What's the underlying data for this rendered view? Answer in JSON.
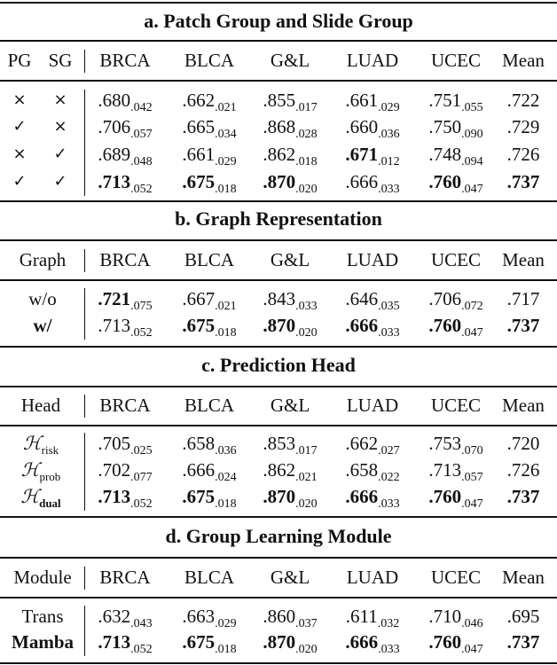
{
  "columns": [
    "BRCA",
    "BLCA",
    "G&L",
    "LUAD",
    "UCEC",
    "Mean"
  ],
  "sections": [
    {
      "title": "a. Patch Group and Slide Group",
      "row_headers": [
        "PG",
        "SG"
      ],
      "rows": [
        {
          "labels": [
            "cross",
            "cross"
          ],
          "values": [
            {
              "v": ".680",
              "s": ".042",
              "b": false
            },
            {
              "v": ".662",
              "s": ".021",
              "b": false
            },
            {
              "v": ".855",
              "s": ".017",
              "b": false
            },
            {
              "v": ".661",
              "s": ".029",
              "b": false
            },
            {
              "v": ".751",
              "s": ".055",
              "b": false
            },
            {
              "v": ".722",
              "s": "",
              "b": false
            }
          ]
        },
        {
          "labels": [
            "check",
            "cross"
          ],
          "values": [
            {
              "v": ".706",
              "s": ".057",
              "b": false
            },
            {
              "v": ".665",
              "s": ".034",
              "b": false
            },
            {
              "v": ".868",
              "s": ".028",
              "b": false
            },
            {
              "v": ".660",
              "s": ".036",
              "b": false
            },
            {
              "v": ".750",
              "s": ".090",
              "b": false
            },
            {
              "v": ".729",
              "s": "",
              "b": false
            }
          ]
        },
        {
          "labels": [
            "cross",
            "check"
          ],
          "values": [
            {
              "v": ".689",
              "s": ".048",
              "b": false
            },
            {
              "v": ".661",
              "s": ".029",
              "b": false
            },
            {
              "v": ".862",
              "s": ".018",
              "b": false
            },
            {
              "v": ".671",
              "s": ".012",
              "b": true
            },
            {
              "v": ".748",
              "s": ".094",
              "b": false
            },
            {
              "v": ".726",
              "s": "",
              "b": false
            }
          ]
        },
        {
          "labels": [
            "check",
            "check"
          ],
          "values": [
            {
              "v": ".713",
              "s": ".052",
              "b": true
            },
            {
              "v": ".675",
              "s": ".018",
              "b": true
            },
            {
              "v": ".870",
              "s": ".020",
              "b": true
            },
            {
              "v": ".666",
              "s": ".033",
              "b": false
            },
            {
              "v": ".760",
              "s": ".047",
              "b": true
            },
            {
              "v": ".737",
              "s": "",
              "b": true
            }
          ]
        }
      ]
    },
    {
      "title": "b. Graph Representation",
      "row_headers": [
        "Graph"
      ],
      "rows": [
        {
          "labels": [
            "w/o"
          ],
          "label_bold": false,
          "values": [
            {
              "v": ".721",
              "s": ".075",
              "b": true
            },
            {
              "v": ".667",
              "s": ".021",
              "b": false
            },
            {
              "v": ".843",
              "s": ".033",
              "b": false
            },
            {
              "v": ".646",
              "s": ".035",
              "b": false
            },
            {
              "v": ".706",
              "s": ".072",
              "b": false
            },
            {
              "v": ".717",
              "s": "",
              "b": false
            }
          ]
        },
        {
          "labels": [
            "w/"
          ],
          "label_bold": true,
          "values": [
            {
              "v": ".713",
              "s": ".052",
              "b": false
            },
            {
              "v": ".675",
              "s": ".018",
              "b": true
            },
            {
              "v": ".870",
              "s": ".020",
              "b": true
            },
            {
              "v": ".666",
              "s": ".033",
              "b": true
            },
            {
              "v": ".760",
              "s": ".047",
              "b": true
            },
            {
              "v": ".737",
              "s": "",
              "b": true
            }
          ]
        }
      ]
    },
    {
      "title": "c. Prediction Head",
      "row_headers": [
        "Head"
      ],
      "rows": [
        {
          "labels": [
            "H"
          ],
          "label_sub": "risk",
          "label_bold": false,
          "values": [
            {
              "v": ".705",
              "s": ".025",
              "b": false
            },
            {
              "v": ".658",
              "s": ".036",
              "b": false
            },
            {
              "v": ".853",
              "s": ".017",
              "b": false
            },
            {
              "v": ".662",
              "s": ".027",
              "b": false
            },
            {
              "v": ".753",
              "s": ".070",
              "b": false
            },
            {
              "v": ".720",
              "s": "",
              "b": false
            }
          ]
        },
        {
          "labels": [
            "H"
          ],
          "label_sub": "prob",
          "label_bold": false,
          "values": [
            {
              "v": ".702",
              "s": ".077",
              "b": false
            },
            {
              "v": ".666",
              "s": ".024",
              "b": false
            },
            {
              "v": ".862",
              "s": ".021",
              "b": false
            },
            {
              "v": ".658",
              "s": ".022",
              "b": false
            },
            {
              "v": ".713",
              "s": ".057",
              "b": false
            },
            {
              "v": ".726",
              "s": "",
              "b": false
            }
          ]
        },
        {
          "labels": [
            "H"
          ],
          "label_sub": "dual",
          "label_bold": true,
          "values": [
            {
              "v": ".713",
              "s": ".052",
              "b": true
            },
            {
              "v": ".675",
              "s": ".018",
              "b": true
            },
            {
              "v": ".870",
              "s": ".020",
              "b": true
            },
            {
              "v": ".666",
              "s": ".033",
              "b": true
            },
            {
              "v": ".760",
              "s": ".047",
              "b": true
            },
            {
              "v": ".737",
              "s": "",
              "b": true
            }
          ]
        }
      ]
    },
    {
      "title": "d. Group Learning Module",
      "row_headers": [
        "Module"
      ],
      "rows": [
        {
          "labels": [
            "Trans"
          ],
          "label_bold": false,
          "values": [
            {
              "v": ".632",
              "s": ".043",
              "b": false
            },
            {
              "v": ".663",
              "s": ".029",
              "b": false
            },
            {
              "v": ".860",
              "s": ".037",
              "b": false
            },
            {
              "v": ".611",
              "s": ".032",
              "b": false
            },
            {
              "v": ".710",
              "s": ".046",
              "b": false
            },
            {
              "v": ".695",
              "s": "",
              "b": false
            }
          ]
        },
        {
          "labels": [
            "Mamba"
          ],
          "label_bold": true,
          "values": [
            {
              "v": ".713",
              "s": ".052",
              "b": true
            },
            {
              "v": ".675",
              "s": ".018",
              "b": true
            },
            {
              "v": ".870",
              "s": ".020",
              "b": true
            },
            {
              "v": ".666",
              "s": ".033",
              "b": true
            },
            {
              "v": ".760",
              "s": ".047",
              "b": true
            },
            {
              "v": ".737",
              "s": "",
              "b": true
            }
          ]
        }
      ]
    }
  ],
  "icons": {
    "check": "✓",
    "cross": "×",
    "calligraphic_H": "ℋ"
  }
}
